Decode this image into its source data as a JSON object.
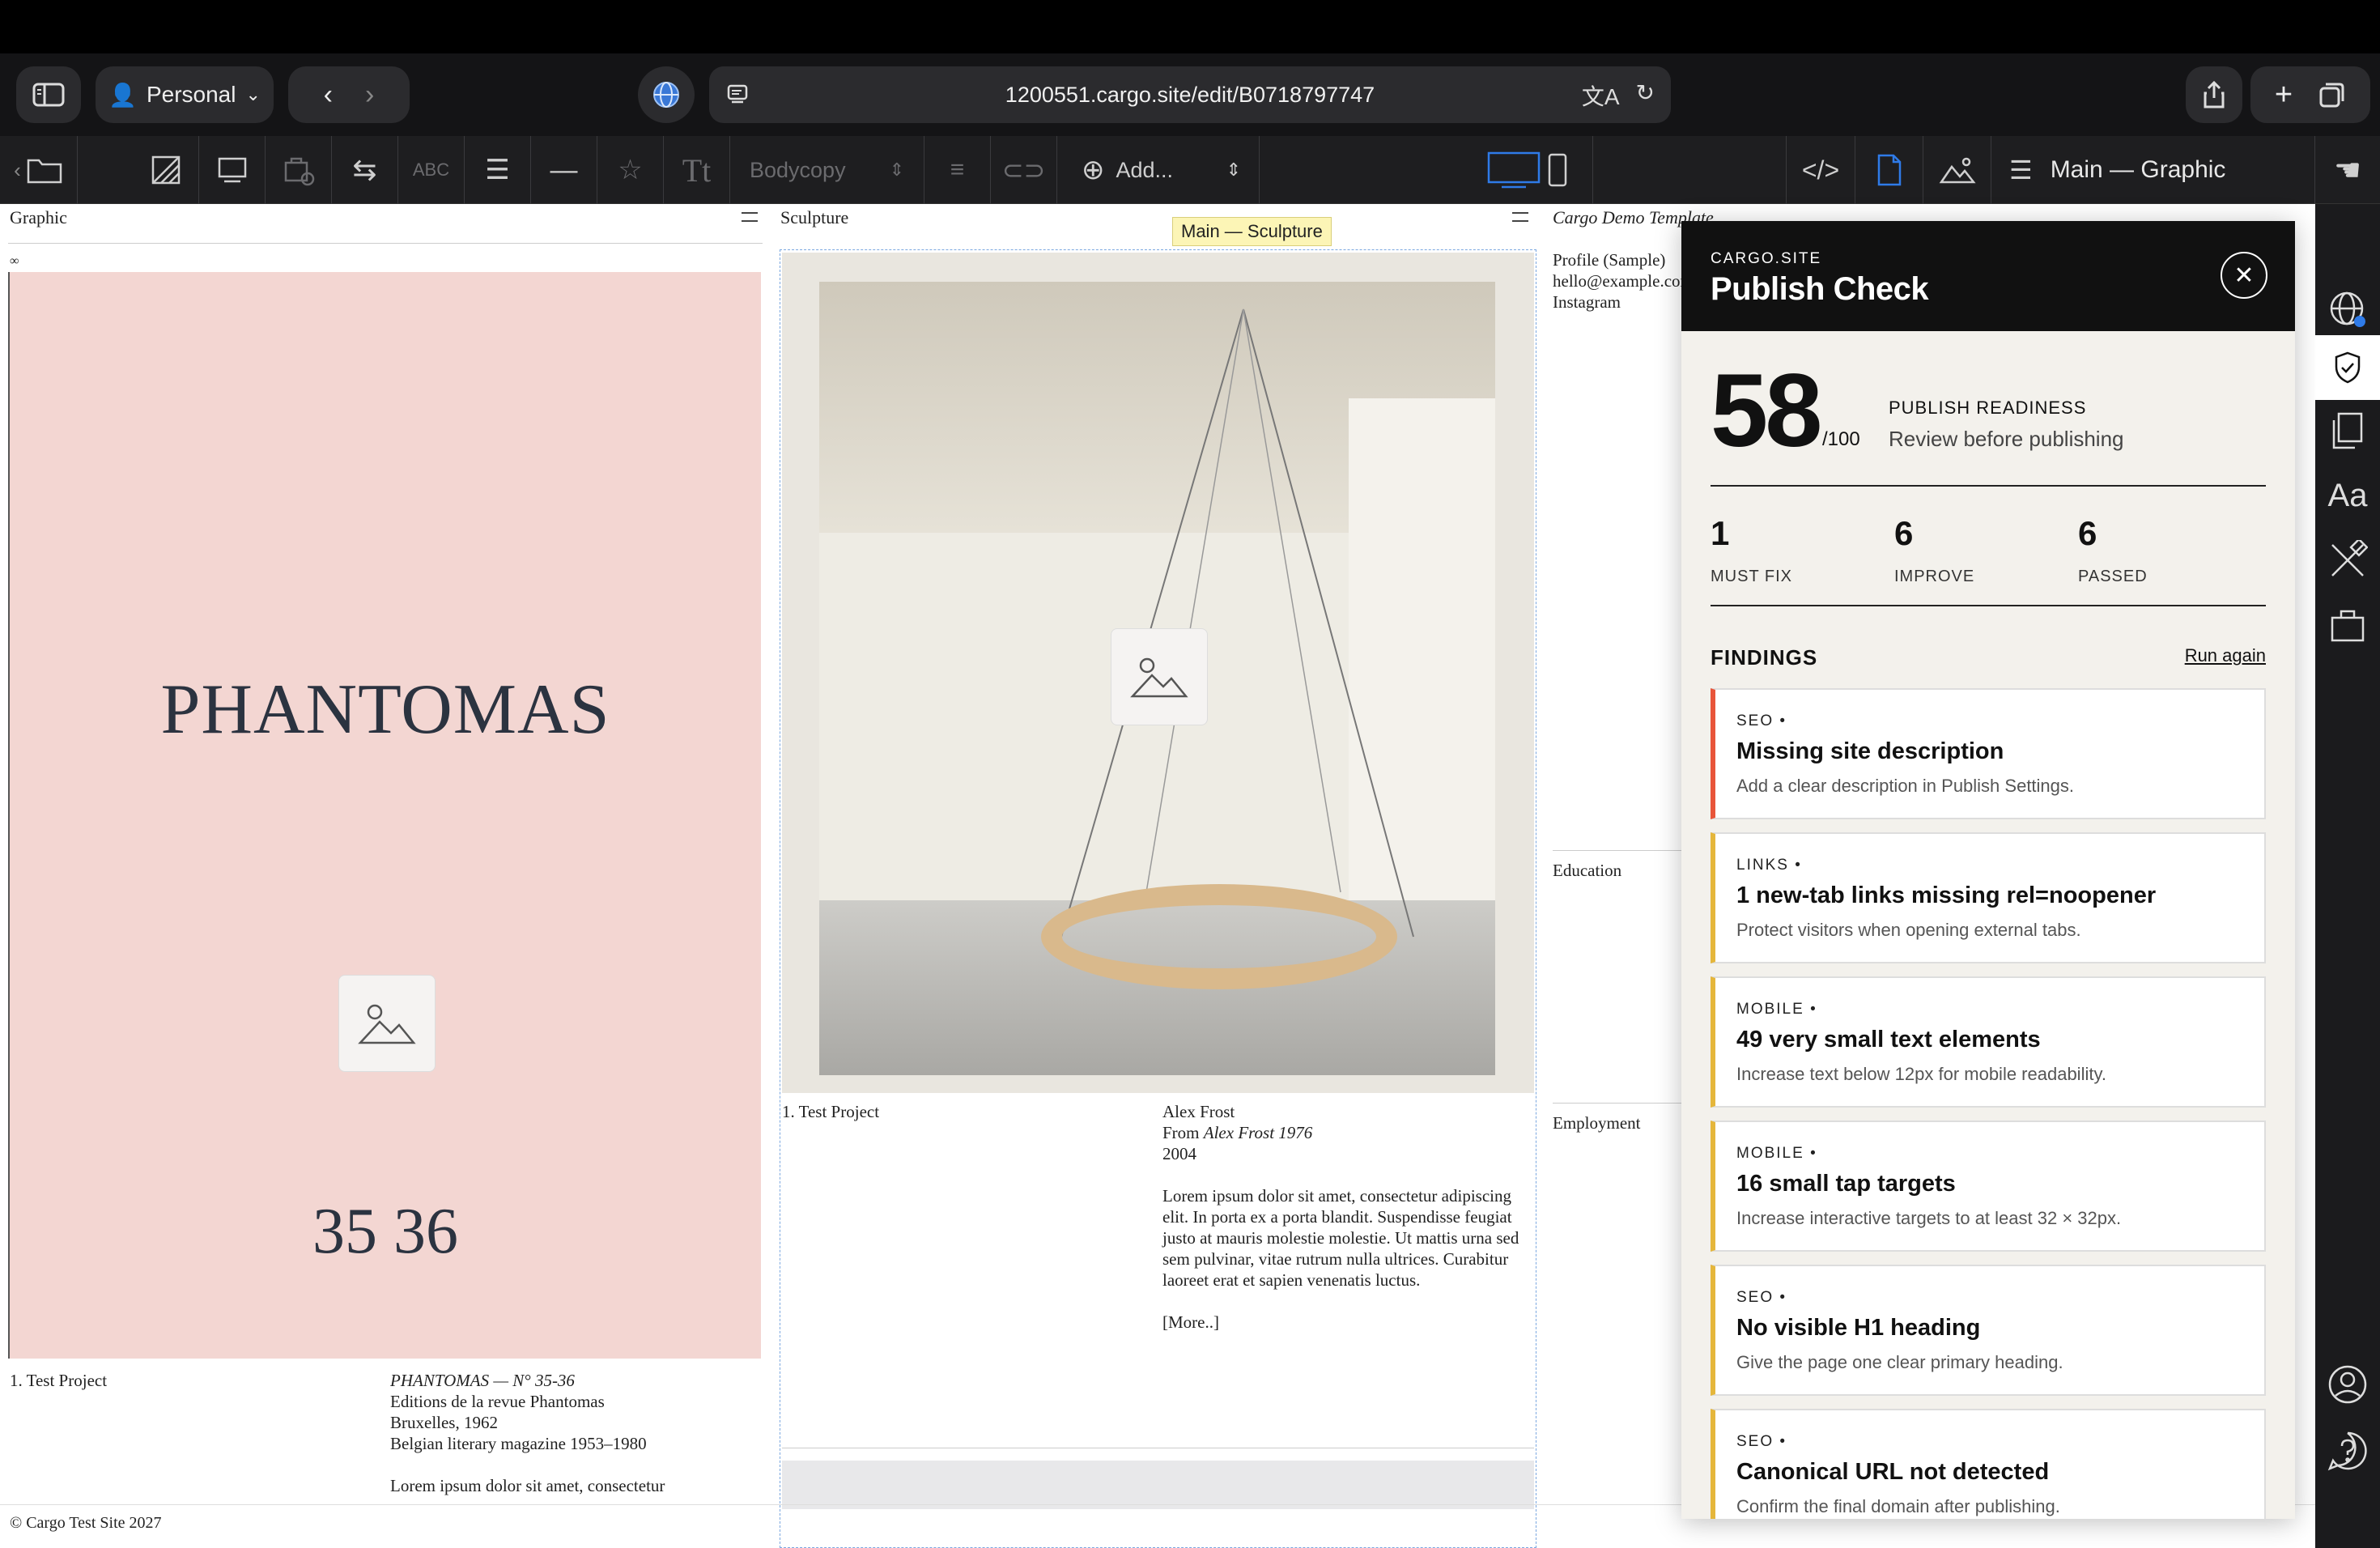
{
  "browser": {
    "profile_label": "Personal",
    "url": "1200551.cargo.site/edit/B0718797747"
  },
  "toolbar": {
    "style_select": "Bodycopy",
    "add_label": "Add...",
    "page_label": "Main — Graphic"
  },
  "canvas": {
    "columns": [
      {
        "title": "Graphic"
      },
      {
        "title": "Sculpture"
      },
      {
        "title": "Cargo Demo Template"
      }
    ],
    "graphic": {
      "small_mark": "∞",
      "cover_title": "PHANTOMAS",
      "cover_number": "35 36",
      "caption_left": "1. Test Project",
      "caption_lines": [
        "PHANTOMAS — N° 35-36",
        "Editions de la revue Phantomas",
        "Bruxelles, 1962",
        "Belgian literary magazine 1953–1980"
      ],
      "lorem_start": "Lorem ipsum dolor sit amet, consectetur"
    },
    "sculpture": {
      "tooltip": "Main — Sculpture",
      "caption_left": "1. Test Project",
      "artist": "Alex Frost",
      "from_prefix": "From ",
      "from_italic": "Alex Frost 1976",
      "year": "2004",
      "body": "Lorem ipsum dolor sit amet, consectetur adipiscing elit. In porta ex a porta blandit. Suspendisse feugiat justo at mauris molestie molestie. Ut mattis urna sed sem pulvinar, vitae rutrum nulla ultrices. Curabitur laoreet erat et sapien venenatis luctus.",
      "more": "[More..]"
    },
    "profile": {
      "lines": [
        "Profile (Sample)",
        "hello@example.com",
        "Instagram"
      ],
      "education": "Education",
      "employment": "Employment"
    },
    "footer": "© Cargo Test Site 2027"
  },
  "panel": {
    "brand": "CARGO.SITE",
    "title": "Publish Check",
    "close": "✕",
    "score": "58",
    "score_of": "/100",
    "readiness_label": "PUBLISH READINESS",
    "readiness_sub": "Review before publishing",
    "stats": [
      {
        "value": "1",
        "label": "MUST FIX"
      },
      {
        "value": "6",
        "label": "IMPROVE"
      },
      {
        "value": "6",
        "label": "PASSED"
      }
    ],
    "findings_heading": "FINDINGS",
    "run_again": "Run again",
    "findings": [
      {
        "category": "SEO  •",
        "title": "Missing site description",
        "desc": "Add a clear description in Publish Settings.",
        "severity_color": "#e8553a"
      },
      {
        "category": "LINKS  •",
        "title": "1 new-tab links missing rel=noopener",
        "desc": "Protect visitors when opening external tabs.",
        "severity_color": "#e5b63b"
      },
      {
        "category": "MOBILE  •",
        "title": "49 very small text elements",
        "desc": "Increase text below 12px for mobile readability.",
        "severity_color": "#e5b63b"
      },
      {
        "category": "MOBILE  •",
        "title": "16 small tap targets",
        "desc": "Increase interactive targets to at least 32 × 32px.",
        "severity_color": "#e5b63b"
      },
      {
        "category": "SEO  •",
        "title": "No visible H1 heading",
        "desc": "Give the page one clear primary heading.",
        "severity_color": "#e5b63b"
      },
      {
        "category": "SEO  •",
        "title": "Canonical URL not detected",
        "desc": "Confirm the final domain after publishing.",
        "severity_color": "#e5b63b"
      }
    ]
  },
  "rail": {
    "type_label": "Aa"
  }
}
